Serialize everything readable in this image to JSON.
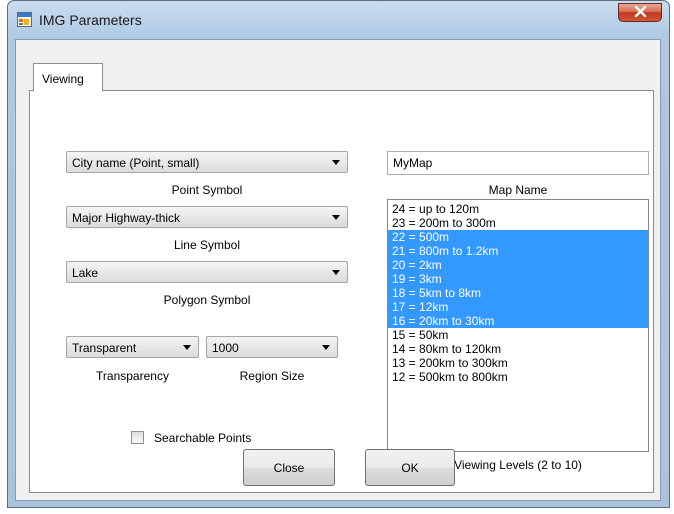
{
  "window": {
    "title": "IMG Parameters",
    "title_icon": "app-window-icon",
    "close_icon": "close-x-icon"
  },
  "tabs": [
    {
      "label": "Viewing",
      "selected": true
    }
  ],
  "point_symbol": {
    "value": "City name (Point, small)",
    "label": "Point Symbol"
  },
  "line_symbol": {
    "value": "Major Highway-thick",
    "label": "Line Symbol"
  },
  "polygon_symbol": {
    "value": "Lake",
    "label": "Polygon Symbol"
  },
  "transparency": {
    "value": "Transparent",
    "label": "Transparency"
  },
  "region_size": {
    "value": "1000",
    "label": "Region Size"
  },
  "searchable_points": {
    "label": "Searchable Points",
    "checked": false
  },
  "map_name": {
    "value": "MyMap",
    "label": "Map Name"
  },
  "viewing_levels": {
    "label": "Viewing Levels (2 to 10)",
    "items": [
      {
        "text": "24 = up to 120m",
        "selected": false
      },
      {
        "text": "23 = 200m to 300m",
        "selected": false
      },
      {
        "text": "22 = 500m",
        "selected": true
      },
      {
        "text": "21 = 800m to 1.2km",
        "selected": true
      },
      {
        "text": "20 = 2km",
        "selected": true
      },
      {
        "text": "19 = 3km",
        "selected": true
      },
      {
        "text": "18 = 5km to 8km",
        "selected": true
      },
      {
        "text": "17 = 12km",
        "selected": true
      },
      {
        "text": "16 = 20km to 30km",
        "selected": true
      },
      {
        "text": "15 = 50km",
        "selected": false
      },
      {
        "text": "14 = 80km to 120km",
        "selected": false
      },
      {
        "text": "13 = 200km to 300km",
        "selected": false
      },
      {
        "text": "12 = 500km to 800km",
        "selected": false
      }
    ]
  },
  "buttons": {
    "close": "Close",
    "ok": "OK"
  },
  "colors": {
    "selection": "#3399ff",
    "window_frame": "#bcd3ea",
    "close_button": "#c9452d"
  }
}
